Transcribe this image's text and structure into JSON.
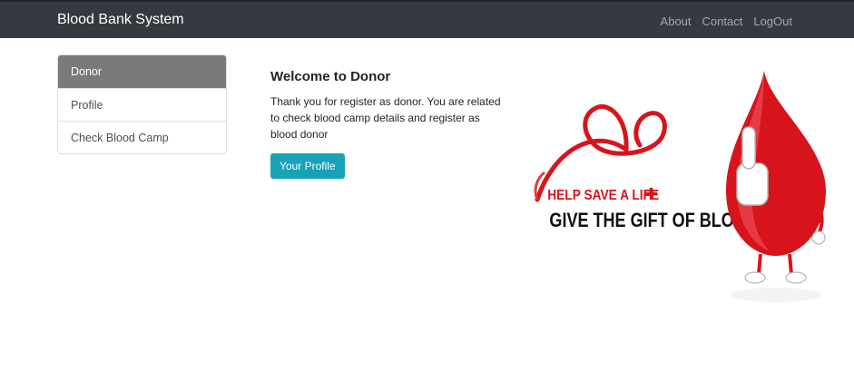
{
  "navbar": {
    "brand": "Blood Bank System",
    "links": [
      "About",
      "Contact",
      "LogOut"
    ]
  },
  "sidebar": {
    "items": [
      {
        "label": "Donor",
        "active": true
      },
      {
        "label": "Profile",
        "active": false
      },
      {
        "label": "Check Blood Camp",
        "active": false
      }
    ]
  },
  "main": {
    "title": "Welcome to Donor",
    "description": "Thank you for register as donor. You are related to check blood camp details and register as blood donor",
    "button_label": "Your Profile"
  },
  "banner": {
    "line1": "HELP SAVE A LIFE",
    "line2": "GIVE THE GIFT OF BLOOD"
  },
  "colors": {
    "navbar": "#343a40",
    "active_item": "#7a7a7a",
    "button": "#17a2b8",
    "blood_red": "#d7141c"
  }
}
